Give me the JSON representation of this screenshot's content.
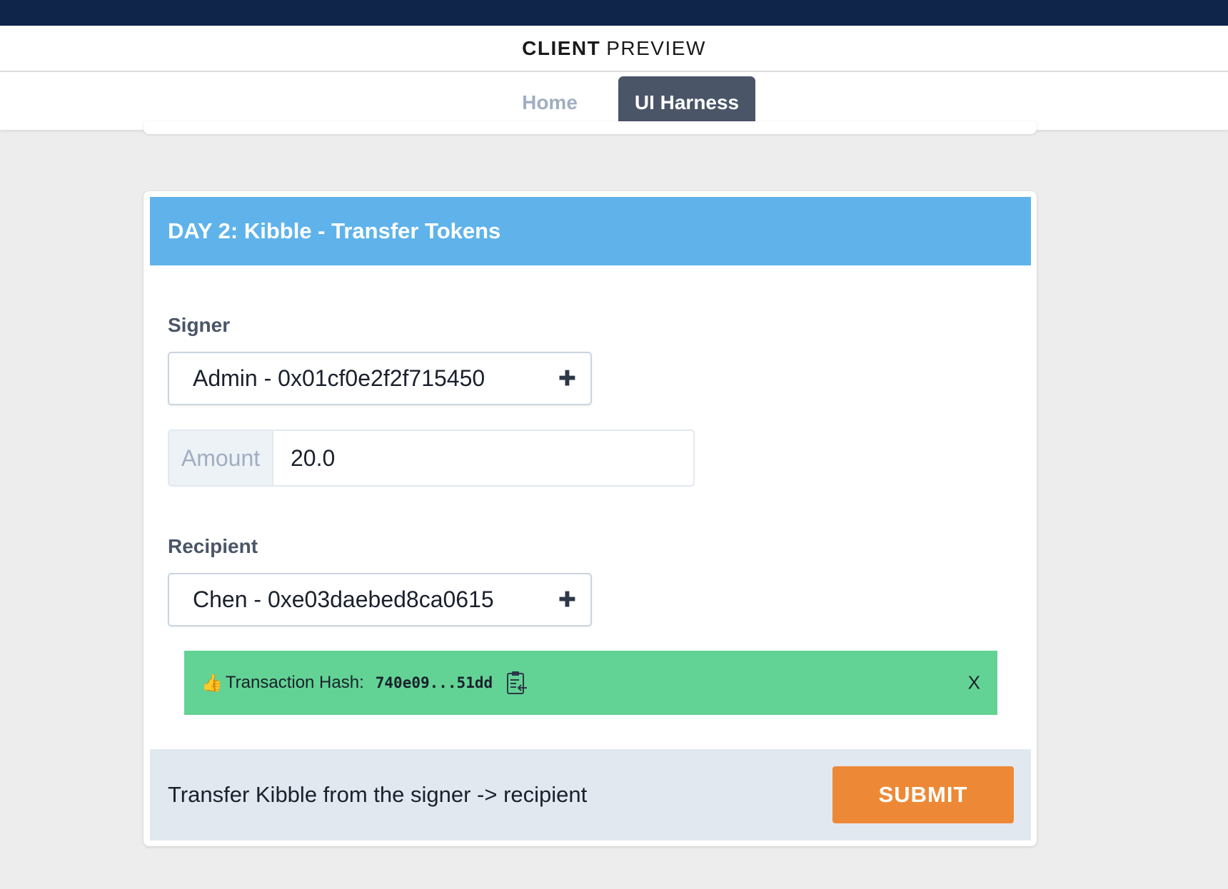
{
  "app": {
    "title_bold": "CLIENT",
    "title_rest": "PREVIEW"
  },
  "nav": {
    "items": [
      {
        "label": "Home",
        "active": false
      },
      {
        "label": "UI Harness",
        "active": true
      }
    ]
  },
  "card": {
    "title": "DAY 2: Kibble - Transfer Tokens",
    "signer": {
      "label": "Signer",
      "value": "Admin - 0x01cf0e2f2f715450"
    },
    "amount": {
      "addon": "Amount",
      "value": "20.0"
    },
    "recipient": {
      "label": "Recipient",
      "value": "Chen - 0xe03daebed8ca0615"
    },
    "transaction": {
      "label": "Transaction Hash:",
      "hash": "740e09...51dd",
      "close": "X"
    },
    "footer": {
      "description": "Transfer Kibble from the signer -> recipient",
      "submit_label": "SUBMIT"
    }
  },
  "colors": {
    "top_strip": "#0f254a",
    "header": "#5fb3ea",
    "success": "#62d394",
    "submit": "#ed8936",
    "nav_active": "#4a5568"
  },
  "icons": {
    "thumb": "thumbs-up-icon",
    "clipboard": "clipboard-copy-icon",
    "plus": "plus-icon"
  }
}
